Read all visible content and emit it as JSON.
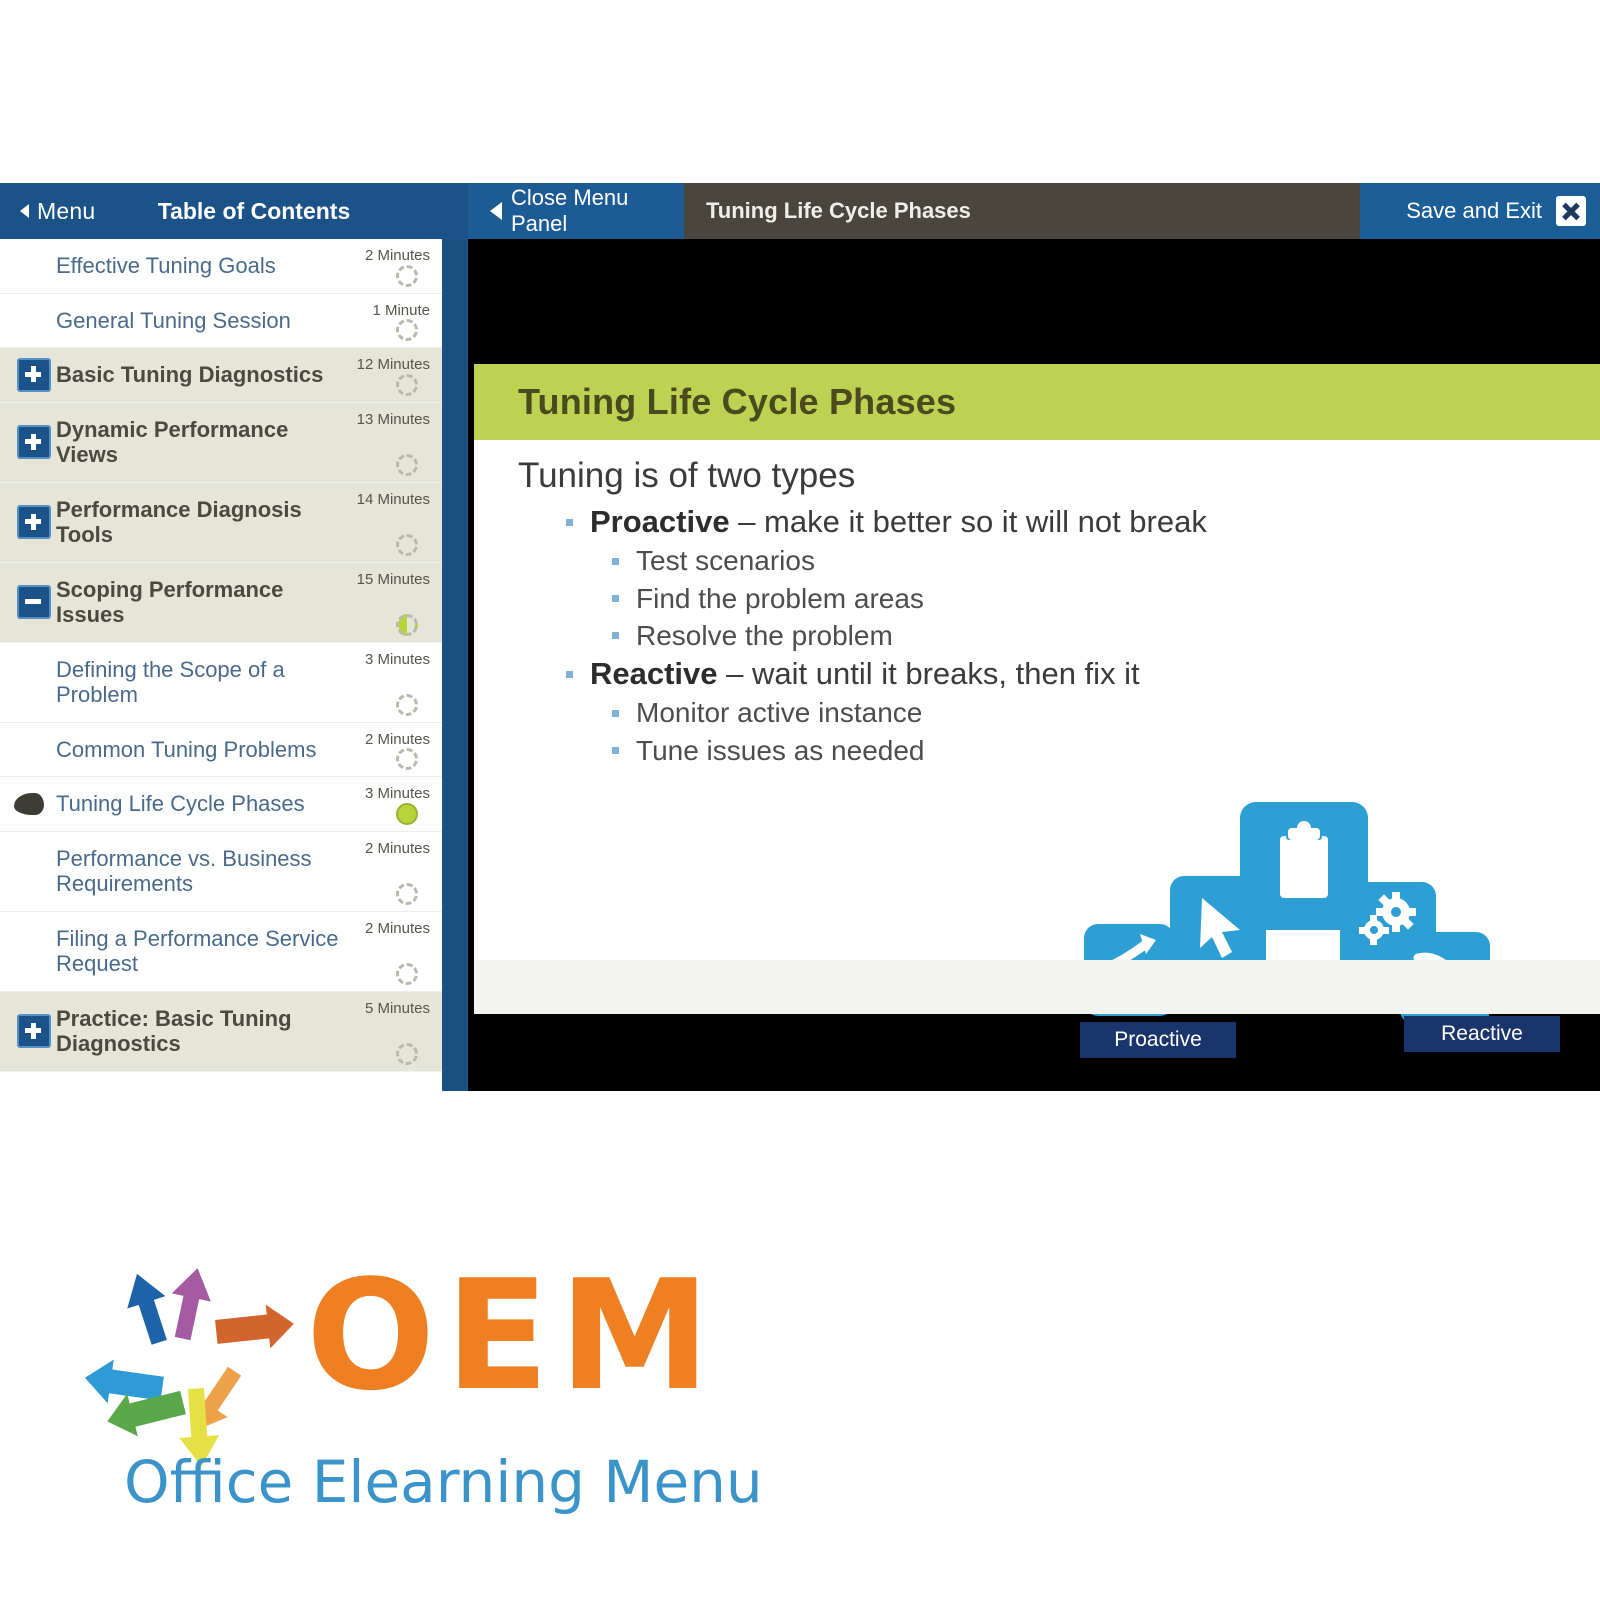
{
  "player": {
    "toc_header": {
      "menu_label": "Menu",
      "title": "Table of Contents",
      "back_icon": "chevron-left-icon"
    },
    "close_panel_label": "Close Menu Panel",
    "close_panel_icon": "triangle-left-icon",
    "slide_title": "Tuning Life Cycle Phases",
    "save_exit_label": "Save and Exit",
    "close_icon": "close-x-icon"
  },
  "toc": {
    "items": [
      {
        "label": "Effective Tuning Goals",
        "minutes": "2 Minutes",
        "type": "leaf",
        "progress": "empty",
        "active": false
      },
      {
        "label": "General Tuning Session",
        "minutes": "1 Minute",
        "type": "leaf",
        "progress": "empty",
        "active": false
      },
      {
        "label": "Basic Tuning Diagnostics",
        "minutes": "12 Minutes",
        "type": "module",
        "expander": "plus",
        "progress": "empty",
        "active": false
      },
      {
        "label": "Dynamic Performance Views",
        "minutes": "13 Minutes",
        "type": "module",
        "expander": "plus",
        "progress": "empty",
        "active": false
      },
      {
        "label": "Performance Diagnosis Tools",
        "minutes": "14 Minutes",
        "type": "module",
        "expander": "plus",
        "progress": "empty",
        "active": false
      },
      {
        "label": "Scoping Performance Issues",
        "minutes": "15 Minutes",
        "type": "module",
        "expander": "minus",
        "progress": "half",
        "active": false
      },
      {
        "label": "Defining the Scope of a Problem",
        "minutes": "3 Minutes",
        "type": "leaf",
        "progress": "empty",
        "active": false
      },
      {
        "label": "Common Tuning Problems",
        "minutes": "2 Minutes",
        "type": "leaf",
        "progress": "empty",
        "active": false
      },
      {
        "label": "Tuning Life Cycle Phases",
        "minutes": "3 Minutes",
        "type": "leaf",
        "progress": "done",
        "active": true
      },
      {
        "label": "Performance vs. Business Requirements",
        "minutes": "2 Minutes",
        "type": "leaf",
        "progress": "empty",
        "active": false
      },
      {
        "label": "Filing a Performance Service Request",
        "minutes": "2 Minutes",
        "type": "leaf",
        "progress": "empty",
        "active": false
      },
      {
        "label": "Practice: Basic Tuning Diagnostics",
        "minutes": "5 Minutes",
        "type": "module",
        "expander": "plus",
        "progress": "empty",
        "active": false
      }
    ]
  },
  "slide": {
    "banner_title": "Tuning Life Cycle Phases",
    "heading": "Tuning is of two types",
    "bullets": [
      {
        "strong": "Proactive",
        "rest": " – make it better so it will not break",
        "sub": [
          "Test scenarios",
          "Find the problem areas",
          "Resolve the problem"
        ]
      },
      {
        "strong": "Reactive",
        "rest": " – wait until it breaks, then fix it",
        "sub": [
          "Monitor active instance",
          "Tune issues as needed"
        ]
      }
    ],
    "graphic": {
      "proactive_label": "Proactive",
      "reactive_label": "Reactive",
      "icons": [
        "clipboard-icon",
        "cursor-arrow-icon",
        "bar-chart-up-icon",
        "gears-icon",
        "bar-chart-down-icon"
      ],
      "tile_color": "#2e9fd4",
      "badge_color": "#19356b"
    }
  },
  "logo": {
    "wordmark": "OEM",
    "tagline": "Office Elearning Menu",
    "wordmark_color": "#ee7f23",
    "tagline_color": "#3b94c9",
    "arrow_colors": [
      "#1d63a8",
      "#a45ba0",
      "#d2642e",
      "#2e9ad6",
      "#eda24a",
      "#5aa84a",
      "#e4e046"
    ]
  }
}
